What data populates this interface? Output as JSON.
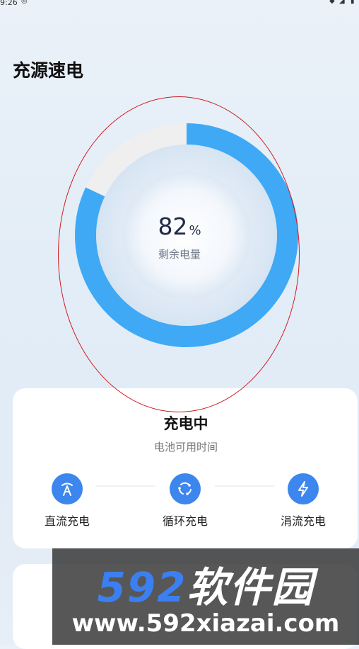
{
  "status_bar": {
    "time": "9:26"
  },
  "page": {
    "title": "充源速电"
  },
  "gauge": {
    "percent": 82,
    "percent_text": "82",
    "unit": "%",
    "label": "剩余电量",
    "fill_color": "#3fa9f5",
    "track_color": "#efefef"
  },
  "charge_card": {
    "title": "充电中",
    "subtitle": "电池可用时间",
    "modes": [
      {
        "label": "直流充电",
        "icon": "dc-charge-icon"
      },
      {
        "label": "循环充电",
        "icon": "cycle-charge-icon"
      },
      {
        "label": "涓流充电",
        "icon": "trickle-charge-icon"
      }
    ],
    "icon_color": "#3d86ee"
  },
  "watermark": {
    "brand_number": "592",
    "brand_text": "软件园",
    "url": "www.592xiazai.com"
  }
}
